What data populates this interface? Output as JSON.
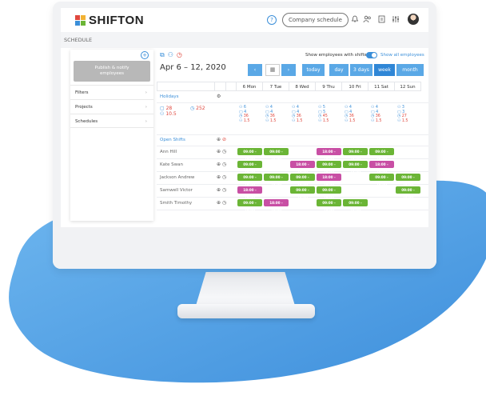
{
  "brand": {
    "name_a": "SHIFTON",
    "name_b": ""
  },
  "topbar": {
    "company_button": "Company schedule",
    "help_icon": "?",
    "icons": [
      "bell-icon",
      "users-icon",
      "calendar-icon",
      "sliders-icon"
    ]
  },
  "breadcrumb": "SCHEDULE",
  "sidebar": {
    "publish_label": "Publish & notify employees",
    "items": [
      {
        "label": "Filters"
      },
      {
        "label": "Projects"
      },
      {
        "label": "Schedules"
      }
    ]
  },
  "main": {
    "date_range": "Apr 6 – 12, 2020",
    "show_employees": "Show employees with shifts",
    "show_all": "Show all employees",
    "nav": {
      "prev": "‹",
      "next": "›",
      "today": "today",
      "day": "day",
      "three_days": "3 days",
      "week": "week",
      "month": "month"
    },
    "days": [
      "6 Mon",
      "7 Tue",
      "8 Wed",
      "9 Thu",
      "10 Fri",
      "11 Sat",
      "12 Sun"
    ],
    "holidays_label": "Holidays",
    "open_shifts_label": "Open Shifts",
    "summary": {
      "a": "28",
      "b": "252",
      "c": "10.5"
    },
    "stats": [
      [
        "6",
        "4",
        "36",
        "1.5"
      ],
      [
        "4",
        "4",
        "36",
        "1.5"
      ],
      [
        "4",
        "4",
        "36",
        "1.5"
      ],
      [
        "5",
        "5",
        "45",
        "1.5"
      ],
      [
        "4",
        "4",
        "36",
        "1.5"
      ],
      [
        "4",
        "4",
        "36",
        "1.5"
      ],
      [
        "3",
        "3",
        "27",
        "1.5"
      ]
    ],
    "employees": [
      {
        "name": "Ann Hill",
        "shifts": [
          [
            "g",
            "09:00 - 18:00"
          ],
          [
            "g",
            "09:00 - 18:00"
          ],
          null,
          [
            "p",
            "18:00 - 19:00"
          ],
          [
            "g",
            "09:00 - 18:00"
          ],
          [
            "g",
            "09:00 - 18:00"
          ],
          null
        ]
      },
      {
        "name": "Kate Swan",
        "shifts": [
          [
            "g",
            "09:00 - 18:00"
          ],
          null,
          [
            "p",
            "18:00 - 19:00"
          ],
          [
            "g",
            "09:00 - 18:00"
          ],
          [
            "g",
            "09:00 - 18:00"
          ],
          [
            "p",
            "18:00 - 19:00"
          ],
          null
        ]
      },
      {
        "name": "Jackson Andrew",
        "shifts": [
          [
            "g",
            "09:00 - 18:00"
          ],
          [
            "g",
            "09:00 - 18:00"
          ],
          [
            "g",
            "09:00 - 18:00"
          ],
          [
            "p",
            "18:00 - 19:00"
          ],
          null,
          [
            "g",
            "09:00 - 18:00"
          ],
          [
            "g",
            "09:00 - 18:00"
          ]
        ]
      },
      {
        "name": "Samwell Victor",
        "shifts": [
          [
            "p",
            "18:00 - 19:00"
          ],
          null,
          [
            "g",
            "09:00 - 18:00"
          ],
          [
            "g",
            "09:00 - 18:00"
          ],
          null,
          null,
          [
            "g",
            "09:00 - 18:00"
          ]
        ]
      },
      {
        "name": "Smith Timothy",
        "shifts": [
          [
            "g",
            "09:00 - 18:00"
          ],
          [
            "p",
            "18:00 - 19:00"
          ],
          null,
          [
            "g",
            "09:00 - 18:00"
          ],
          [
            "g",
            "09:00 - 18:00"
          ],
          null,
          null
        ]
      }
    ]
  },
  "colors": {
    "accent": "#3b8fd9",
    "green": "#6bb536",
    "purple": "#c84fa4",
    "blob": "#4a9fe3"
  }
}
